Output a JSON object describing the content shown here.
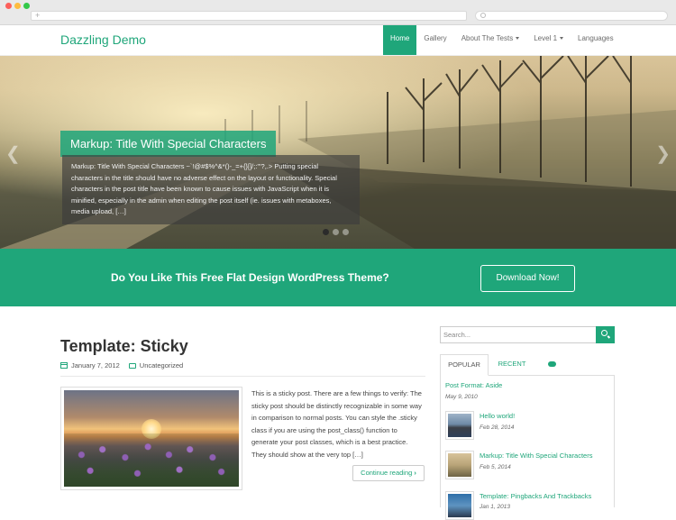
{
  "browser": {
    "url_placeholder": "+"
  },
  "header": {
    "site_title": "Dazzling Demo",
    "nav": [
      {
        "label": "Home",
        "active": true
      },
      {
        "label": "Gallery"
      },
      {
        "label": "About The Tests",
        "dropdown": true
      },
      {
        "label": "Level 1",
        "dropdown": true
      },
      {
        "label": "Languages"
      }
    ]
  },
  "slider": {
    "title": "Markup: Title With Special Characters",
    "text": "Markup: Title With Special Characters ~`!@#$%^&*()-_=+{}[]/;:'\"?,.> Putting special characters in the title should have no adverse effect on the layout or functionality. Special characters in the post title have been known to cause issues with JavaScript when it is minified, especially in the admin when editing the post itself (ie. issues with metaboxes, media upload, […]",
    "prev_icon": "chevron-left-icon",
    "next_icon": "chevron-right-icon",
    "slide_count": 3,
    "active_slide": 1
  },
  "cta": {
    "text": "Do You Like This Free Flat Design WordPress Theme?",
    "button": "Download Now!"
  },
  "post": {
    "title": "Template: Sticky",
    "date": "January 7, 2012",
    "category": "Uncategorized",
    "excerpt": "This is a sticky post. There are a few things to verify: The sticky post should be distinctly recognizable in some way in comparison to normal posts. You can style the .sticky class if you are using the post_class() function to generate your post classes, which is a best practice. They should show at the very top […]",
    "read_more": "Continue reading"
  },
  "sidebar": {
    "search_placeholder": "Search...",
    "tabs": [
      "POPULAR",
      "RECENT"
    ],
    "popular": {
      "first": {
        "title": "Post Format: Aside",
        "date": "May 9, 2010"
      },
      "items": [
        {
          "title": "Hello world!",
          "date": "Feb 28, 2014"
        },
        {
          "title": "Markup: Title With Special Characters",
          "date": "Feb 5, 2014"
        },
        {
          "title": "Template: Pingbacks And Trackbacks",
          "date": "Jan 1, 2013"
        }
      ]
    }
  },
  "colors": {
    "accent": "#1fa67a"
  }
}
